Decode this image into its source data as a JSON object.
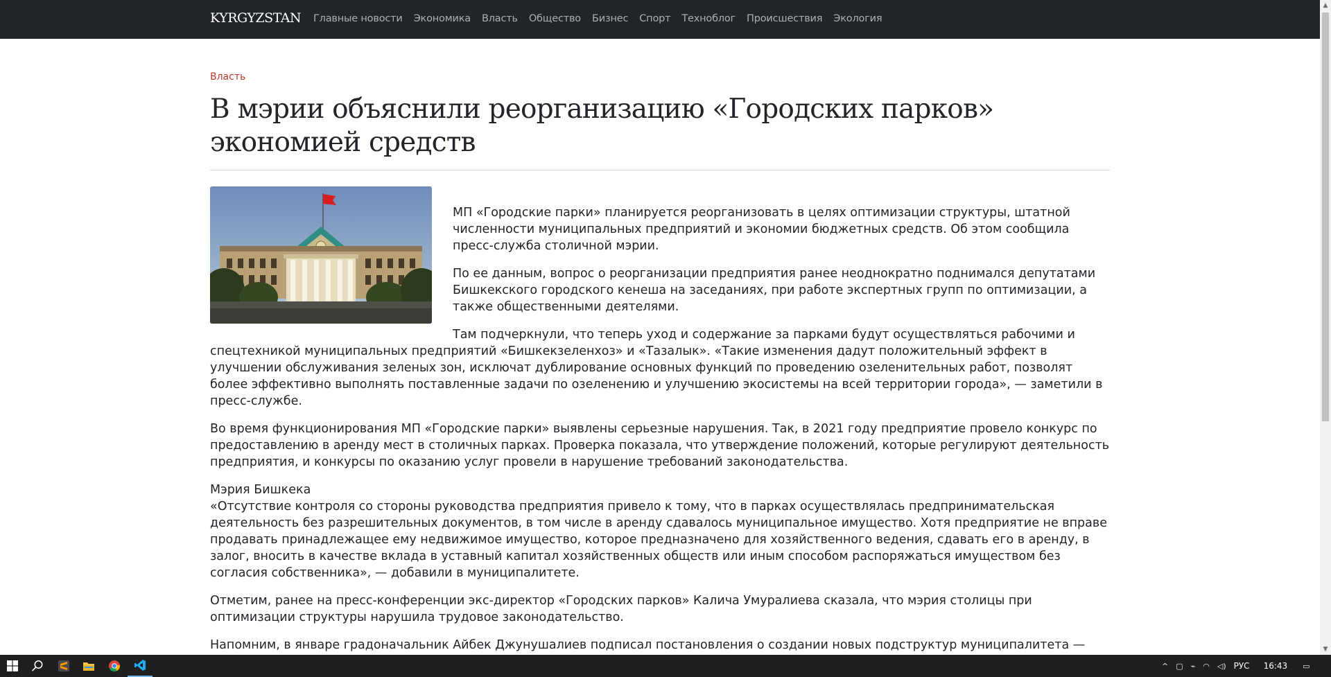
{
  "site": {
    "brand": "KYRGYZSTAN",
    "nav": [
      "Главные новости",
      "Экономика",
      "Власть",
      "Общество",
      "Бизнес",
      "Спорт",
      "Техноблог",
      "Происшествия",
      "Экология"
    ]
  },
  "article": {
    "category": "Власть",
    "title": "В мэрии объяснили реорганизацию «Городских парков» экономией средств",
    "image_alt": "Здание мэрии Бишкека",
    "paragraphs": [
      "МП «Городские парки» планируется реорганизовать в целях оптимизации структуры, штатной численности муниципальных предприятий и экономии бюджетных средств. Об этом сообщила пресс-служба столичной мэрии.",
      "По ее данным, вопрос о реорганизации предприятия ранее неоднократно поднимался депутатами Бишкекского городского кенеша на заседаниях, при работе экспертных групп по оптимизации, а также общественными деятелями.",
      "Там подчеркнули, что теперь уход и содержание за парками будут осуществляться рабочими и спецтехникой муниципальных предприятий «Бишкекзеленхоз» и «Тазалык». «Такие изменения дадут положительный эффект в улучшении обслуживания зеленых зон, исключат дублирование основных функций по проведению озеленительных работ, позволят более эффективно выполнять поставленные задачи по озеленению и улучшению экосистемы на всей территории города», — заметили в пресс-службе.",
      "Во время функционирования МП «Городские парки» выявлены серьезные нарушения. Так, в 2021 году предприятие провело конкурс по предоставлению в аренду мест в столичных парках. Проверка показала, что утверждение положений, которые регулируют деятельность предприятия, и конкурсы по оказанию услуг провели в нарушение требований законодательства."
    ],
    "quote_source": "Мэрия Бишкека",
    "quote": "«Отсутствие контроля со стороны руководства предприятия привело к тому, что в парках осуществлялась предпринимательская деятельность без разрешительных документов, в том числе в аренду сдавалось муниципальное имущество. Хотя предприятие не вправе продавать принадлежащее ему недвижимое имущество, которое предназначено для хозяйственного ведения, сдавать его в аренду, в залог, вносить в качестве вклада в уставный капитал хозяйственных обществ или иным способом распоряжаться имуществом без согласия собственника», — добавили в муниципалитете.",
    "paragraphs_after": [
      "Отметим, ранее на пресс-конференции экс-директор «Городских парков» Калича Умуралиева сказала, что мэрия столицы при оптимизации структуры нарушила трудовое законодательство.",
      "Напомним, в январе градоначальник Айбек Джунушалиев подписал постановления о создании новых подструктур муниципалитета — департамента по управлению муниципальным имуществом, департамента транспорта и развития дорожно-транспортной инфраструктуры и"
    ]
  },
  "taskbar": {
    "language": "РУС",
    "time": "16:43",
    "apps": [
      "windows-start-icon",
      "search-icon",
      "sublime-text-icon",
      "file-explorer-icon",
      "chrome-icon",
      "vscode-icon"
    ]
  },
  "colors": {
    "navbar": "#212529",
    "category": "#c0392b",
    "taskbar": "#1f1f1f"
  }
}
